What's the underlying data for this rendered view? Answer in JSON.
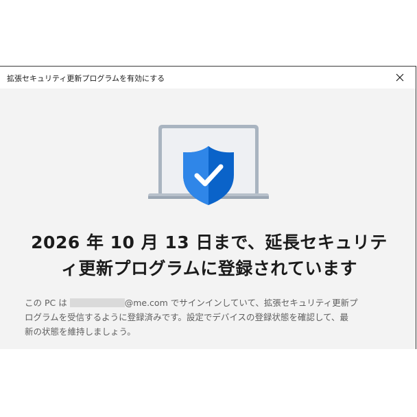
{
  "window": {
    "title": "拡張セキュリティ更新プログラムを有効にする",
    "close_icon": "close-icon"
  },
  "main": {
    "illustration_icon": "laptop-shield-check-icon",
    "headline_line1": "2026 年 10 月 13 日まで、延長セキュリテ",
    "headline_line2": "ィ更新プログラムに登録されています",
    "description": {
      "prefix": "この PC は",
      "email_suffix": "@me.com",
      "rest_line1": " でサインインしていて、拡張セキュリティ更新プ",
      "line2": "ログラムを受信するように登録済みです。設定でデバイスの登録状態を確認して、最",
      "line3": "新の状態を維持しましょう。"
    }
  },
  "colors": {
    "shield": "#0a63c9",
    "shield_light": "#2f86e8",
    "laptop_frame": "#a9b4c0",
    "laptop_screen": "#eef0f3",
    "background": "#f3f3f3"
  }
}
